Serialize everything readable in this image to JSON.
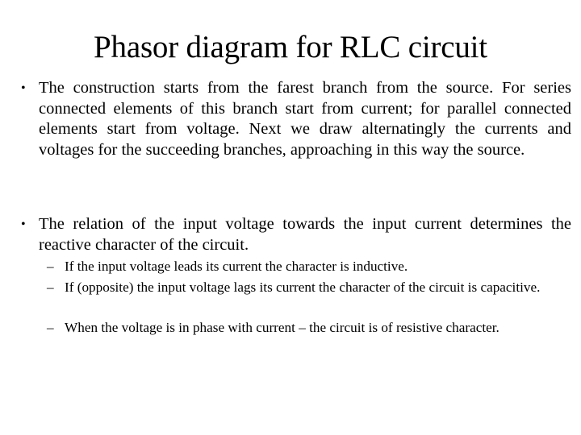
{
  "slide": {
    "title": "Phasor diagram for RLC circuit",
    "bullets": [
      {
        "marker": "•",
        "text": "The construction starts from the farest branch from the source. For series connected elements of this branch start from current; for parallel connected elements start from voltage. Next we draw alternatingly the currents and voltages for the succeeding branches, approaching in this way the source."
      },
      {
        "marker": "•",
        "text": "The relation of the input voltage towards the input current determines the reactive character of the circuit.",
        "sub_items": [
          {
            "marker": "–",
            "text": "If the input voltage leads its current the character is inductive."
          },
          {
            "marker": "–",
            "text": " If (opposite) the input voltage lags its current the character of the circuit is capacitive."
          },
          {
            "marker": "–",
            "text": "When the voltage is in phase with current – the circuit is of resistive character."
          }
        ]
      }
    ]
  }
}
